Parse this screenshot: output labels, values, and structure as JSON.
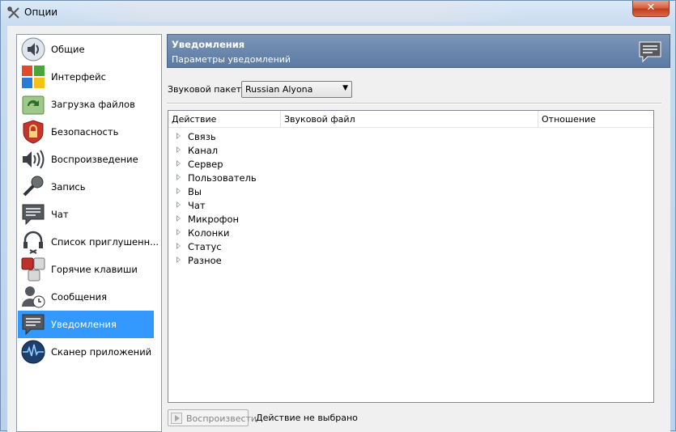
{
  "window": {
    "title": "Опции",
    "close_symbol": "✕"
  },
  "sidebar": {
    "items": [
      {
        "label": "Общие",
        "icon": "speaker-on-icon"
      },
      {
        "label": "Интерфейс",
        "icon": "windows-logo-icon"
      },
      {
        "label": "Загрузка файлов",
        "icon": "file-transfer-icon"
      },
      {
        "label": "Безопасность",
        "icon": "lock-shield-icon"
      },
      {
        "label": "Воспроизведение",
        "icon": "speaker-waves-icon"
      },
      {
        "label": "Запись",
        "icon": "microphone-icon"
      },
      {
        "label": "Чат",
        "icon": "chat-bubble-icon"
      },
      {
        "label": "Список приглушенн...",
        "icon": "muted-headset-icon"
      },
      {
        "label": "Горячие клавиши",
        "icon": "hotkeys-icon"
      },
      {
        "label": "Сообщения",
        "icon": "user-clock-icon"
      },
      {
        "label": "Уведомления",
        "icon": "notification-bubble-icon",
        "selected": true
      },
      {
        "label": "Сканер приложений",
        "icon": "app-scanner-icon"
      }
    ]
  },
  "panel": {
    "title": "Уведомления",
    "subtitle": "Параметры уведомлений"
  },
  "sound_pack": {
    "label": "Звуковой пакет:",
    "value": "Russian Alyona"
  },
  "tree": {
    "columns": [
      "Действие",
      "Звуковой файл",
      "Отношение"
    ],
    "rows": [
      "Связь",
      "Канал",
      "Сервер",
      "Пользователь",
      "Вы",
      "Чат",
      "Микрофон",
      "Колонки",
      "Статус",
      "Разное"
    ]
  },
  "footer": {
    "play_label": "Воспроизвести",
    "status": "Действие не выбрано"
  },
  "colors": {
    "selection": "#3399ff",
    "header_top": "#7d95b6",
    "header_bottom": "#5b7aa3"
  }
}
